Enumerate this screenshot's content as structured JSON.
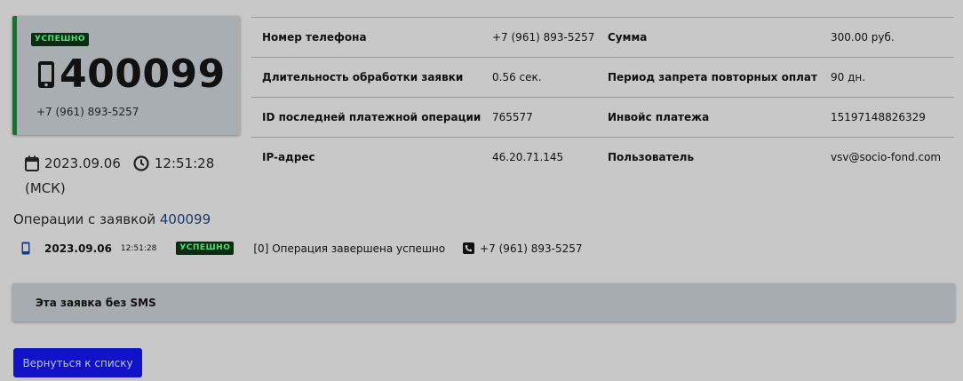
{
  "card": {
    "status_badge": "УСПЕШНО",
    "request_id": "400099",
    "phone": "+7 (961) 893-5257",
    "icon": "mobile-phone-icon"
  },
  "datetime": {
    "date": "2023.09.06",
    "time": "12:51:28",
    "timezone": "(МСК)"
  },
  "info": {
    "rows": [
      {
        "label1": "Номер телефона",
        "value1": "+7 (961) 893-5257",
        "label2": "Сумма",
        "value2": "300.00 руб."
      },
      {
        "label1": "Длительность обработки заявки",
        "value1": "0.56 сек.",
        "label2": "Период запрета повторных оплат",
        "value2": "90 дн."
      },
      {
        "label1": "ID последней платежной операции",
        "value1": "765577",
        "label2": "Инвойс платежа",
        "value2": "15197148826329"
      },
      {
        "label1": "IP-адрес",
        "value1": "46.20.71.145",
        "label2": "Пользователь",
        "value2": "vsv@socio-fond.com"
      }
    ]
  },
  "operations": {
    "title": "Операции с заявкой",
    "title_link": "400099",
    "items": [
      {
        "date": "2023.09.06",
        "time": "12:51:28",
        "status": "УСПЕШНО",
        "message": "[0] Операция завершена успешно",
        "phone": "+7 (961) 893-5257"
      }
    ]
  },
  "sms": {
    "text": "Эта заявка без SMS"
  },
  "actions": {
    "back_label": "Вернуться к списку"
  },
  "colors": {
    "background": "#c8c8c8",
    "card_accent": "#1f6b3a",
    "badge_bg": "#0d2a12",
    "badge_text": "#4fe07a",
    "button_bg": "#1111c8",
    "link": "#173a6a"
  }
}
